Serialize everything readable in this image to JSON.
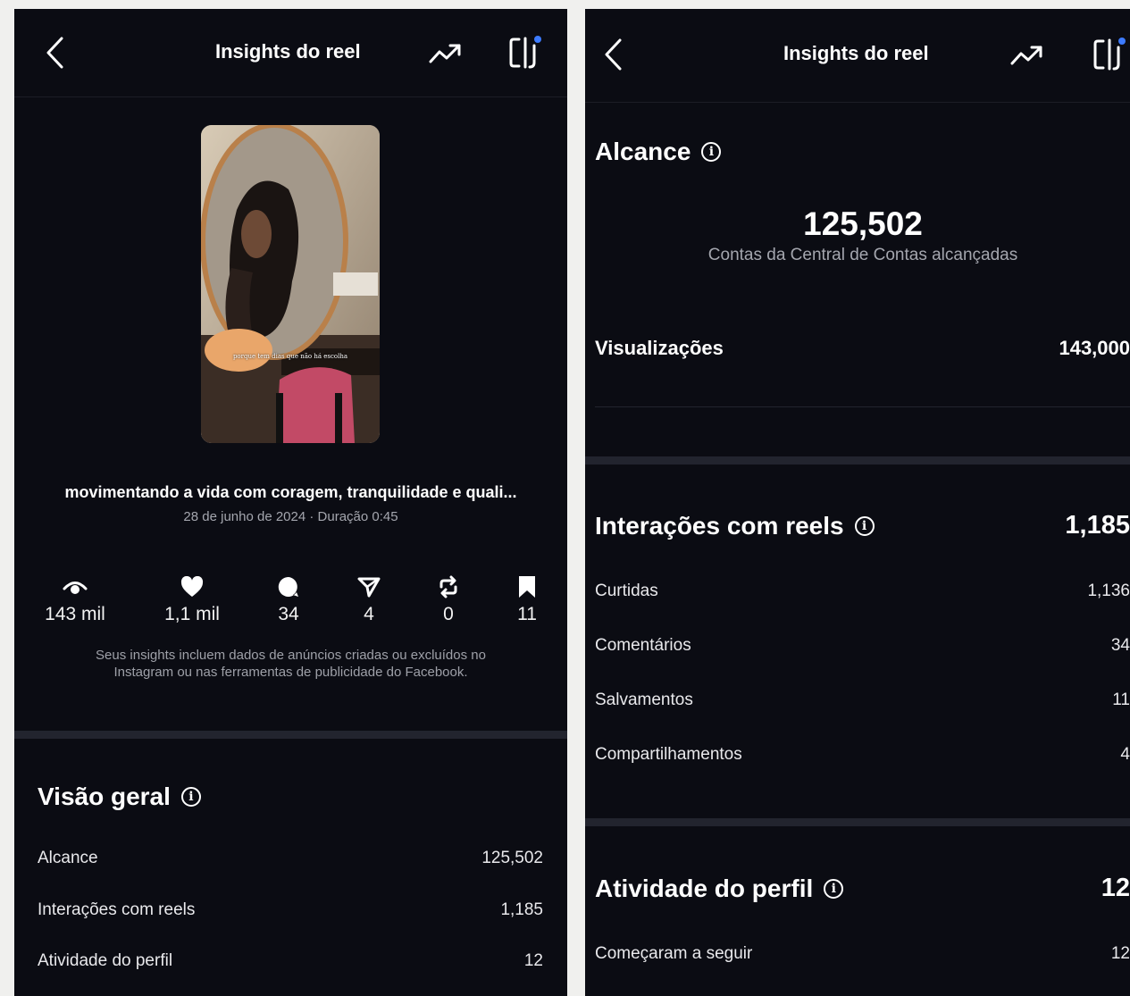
{
  "left": {
    "header": {
      "title": "Insights do reel"
    },
    "thumbnail": {
      "overlay_text": "porque tem dias que não há escolha"
    },
    "caption": "movimentando a vida com coragem, tranquilidade e quali...",
    "meta": "28 de junho de 2024 · Duração 0:45",
    "stats": [
      {
        "icon": "eye-icon",
        "value": "143 mil"
      },
      {
        "icon": "heart-icon",
        "value": "1,1 mil"
      },
      {
        "icon": "comment-icon",
        "value": "34"
      },
      {
        "icon": "share-icon",
        "value": "4"
      },
      {
        "icon": "repost-icon",
        "value": "0"
      },
      {
        "icon": "bookmark-icon",
        "value": "11"
      }
    ],
    "note_line1": "Seus insights incluem dados de anúncios criadas ou excluídos no",
    "note_line2": "Instagram ou nas ferramentas de publicidade do Facebook.",
    "overview": {
      "title": "Visão geral",
      "rows": [
        {
          "label": "Alcance",
          "value": "125,502"
        },
        {
          "label": "Interações com reels",
          "value": "1,185"
        },
        {
          "label": "Atividade do perfil",
          "value": "12"
        }
      ]
    }
  },
  "right": {
    "header": {
      "title": "Insights do reel"
    },
    "reach": {
      "title": "Alcance",
      "value": "125,502",
      "subtitle": "Contas da Central de Contas alcançadas",
      "views_label": "Visualizações",
      "views_value": "143,000"
    },
    "interactions": {
      "title": "Interações com reels",
      "total": "1,185",
      "rows": [
        {
          "label": "Curtidas",
          "value": "1,136"
        },
        {
          "label": "Comentários",
          "value": "34"
        },
        {
          "label": "Salvamentos",
          "value": "11"
        },
        {
          "label": "Compartilhamentos",
          "value": "4"
        }
      ]
    },
    "activity": {
      "title": "Atividade do perfil",
      "total": "12",
      "rows": [
        {
          "label": "Começaram a seguir",
          "value": "12"
        }
      ]
    }
  },
  "colors": {
    "background": "#0b0c13",
    "divider": "#22242e",
    "muted_text": "#a4a6ae",
    "badge_dot": "#3d7bff"
  }
}
